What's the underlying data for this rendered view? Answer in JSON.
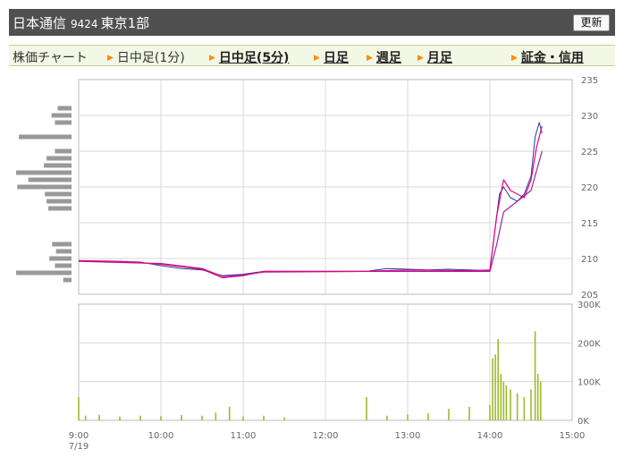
{
  "header": {
    "company": "日本通信",
    "code": "9424",
    "market": "東京1部",
    "refresh_label": "更新"
  },
  "tabs": [
    {
      "label": "株価チャート",
      "active": false,
      "arrow": false
    },
    {
      "label": "日中足(1分)",
      "active": false,
      "arrow": true
    },
    {
      "label": "日中足(5分)",
      "active": true,
      "arrow": true
    },
    {
      "label": "日足",
      "active": true,
      "arrow": true
    },
    {
      "label": "週足",
      "active": true,
      "arrow": true
    },
    {
      "label": "月足",
      "active": true,
      "arrow": true
    },
    {
      "label": "証金・信用",
      "active": true,
      "arrow": true
    }
  ],
  "chart_data": {
    "type": "line",
    "date_label": "7/19",
    "x_ticks": [
      "9:00",
      "10:00",
      "11:00",
      "12:00",
      "13:00",
      "14:00",
      "15:00"
    ],
    "price_axis": {
      "min": 205,
      "max": 235,
      "ticks": [
        205,
        210,
        215,
        220,
        225,
        230,
        235
      ]
    },
    "volume_axis": {
      "min": 0,
      "max": 300000,
      "ticks": [
        "0K",
        "100K",
        "200K",
        "300K"
      ]
    },
    "colors": {
      "candle": "#1f3f99",
      "ma_short": "#e8007d",
      "ma_long": "#a020a0",
      "volume": "#9dba2e",
      "profile": "#999999",
      "grid": "#d8d8d8"
    },
    "price_series": [
      [
        "9:00",
        209.7
      ],
      [
        "9:15",
        209.6
      ],
      [
        "9:30",
        209.6
      ],
      [
        "9:45",
        209.5
      ],
      [
        "10:00",
        209.0
      ],
      [
        "10:15",
        208.6
      ],
      [
        "10:30",
        208.4
      ],
      [
        "10:45",
        207.6
      ],
      [
        "11:00",
        207.8
      ],
      [
        "11:15",
        208.2
      ],
      [
        "11:30",
        208.2
      ],
      [
        "12:30",
        208.2
      ],
      [
        "12:45",
        208.6
      ],
      [
        "13:00",
        208.5
      ],
      [
        "13:15",
        208.4
      ],
      [
        "13:30",
        208.5
      ],
      [
        "13:45",
        208.4
      ],
      [
        "14:00",
        208.3
      ],
      [
        "14:03",
        213.0
      ],
      [
        "14:07",
        219.0
      ],
      [
        "14:10",
        220.0
      ],
      [
        "14:15",
        218.5
      ],
      [
        "14:20",
        218.0
      ],
      [
        "14:25",
        219.0
      ],
      [
        "14:30",
        221.5
      ],
      [
        "14:33",
        227.0
      ],
      [
        "14:36",
        229.0
      ],
      [
        "14:38",
        227.5
      ]
    ],
    "ma_short": [
      [
        "9:00",
        209.7
      ],
      [
        "9:30",
        209.6
      ],
      [
        "10:00",
        209.2
      ],
      [
        "10:30",
        208.5
      ],
      [
        "10:45",
        207.3
      ],
      [
        "11:00",
        207.6
      ],
      [
        "11:15",
        208.2
      ],
      [
        "12:30",
        208.2
      ],
      [
        "13:00",
        208.4
      ],
      [
        "13:45",
        208.3
      ],
      [
        "14:00",
        208.4
      ],
      [
        "14:05",
        216.0
      ],
      [
        "14:10",
        221.0
      ],
      [
        "14:15",
        219.5
      ],
      [
        "14:20",
        219.0
      ],
      [
        "14:25",
        218.5
      ],
      [
        "14:30",
        221.0
      ],
      [
        "14:34",
        225.5
      ],
      [
        "14:38",
        228.5
      ]
    ],
    "ma_long": [
      [
        "9:00",
        209.6
      ],
      [
        "10:00",
        209.3
      ],
      [
        "10:30",
        208.6
      ],
      [
        "10:45",
        207.5
      ],
      [
        "11:00",
        207.7
      ],
      [
        "11:15",
        208.1
      ],
      [
        "12:30",
        208.2
      ],
      [
        "14:00",
        208.2
      ],
      [
        "14:05",
        212.0
      ],
      [
        "14:10",
        216.5
      ],
      [
        "14:20",
        218.0
      ],
      [
        "14:30",
        219.5
      ],
      [
        "14:38",
        225.0
      ]
    ],
    "volume_bars": [
      [
        "9:00",
        60000
      ],
      [
        "9:05",
        12000
      ],
      [
        "9:15",
        14000
      ],
      [
        "9:30",
        10000
      ],
      [
        "9:45",
        12000
      ],
      [
        "10:00",
        11000
      ],
      [
        "10:15",
        14000
      ],
      [
        "10:30",
        12000
      ],
      [
        "10:40",
        20000
      ],
      [
        "10:50",
        35000
      ],
      [
        "11:00",
        10000
      ],
      [
        "11:15",
        12000
      ],
      [
        "11:30",
        8000
      ],
      [
        "12:30",
        60000
      ],
      [
        "12:45",
        12000
      ],
      [
        "13:00",
        15000
      ],
      [
        "13:15",
        18000
      ],
      [
        "13:30",
        30000
      ],
      [
        "13:45",
        35000
      ],
      [
        "14:00",
        40000
      ],
      [
        "14:02",
        160000
      ],
      [
        "14:04",
        170000
      ],
      [
        "14:06",
        210000
      ],
      [
        "14:08",
        120000
      ],
      [
        "14:10",
        100000
      ],
      [
        "14:12",
        90000
      ],
      [
        "14:15",
        80000
      ],
      [
        "14:20",
        70000
      ],
      [
        "14:25",
        60000
      ],
      [
        "14:30",
        80000
      ],
      [
        "14:33",
        230000
      ],
      [
        "14:35",
        120000
      ],
      [
        "14:37",
        100000
      ]
    ],
    "price_profile": [
      [
        231,
        0.25
      ],
      [
        230,
        0.36
      ],
      [
        229,
        0.3
      ],
      [
        227,
        0.95
      ],
      [
        225,
        0.3
      ],
      [
        224,
        0.45
      ],
      [
        223,
        0.5
      ],
      [
        222,
        1.0
      ],
      [
        221,
        0.78
      ],
      [
        220,
        0.98
      ],
      [
        219,
        0.48
      ],
      [
        218,
        0.45
      ],
      [
        217,
        0.42
      ],
      [
        212,
        0.35
      ],
      [
        211,
        0.28
      ],
      [
        210,
        0.4
      ],
      [
        209,
        0.3
      ],
      [
        208,
        1.0
      ],
      [
        207,
        0.15
      ]
    ]
  }
}
